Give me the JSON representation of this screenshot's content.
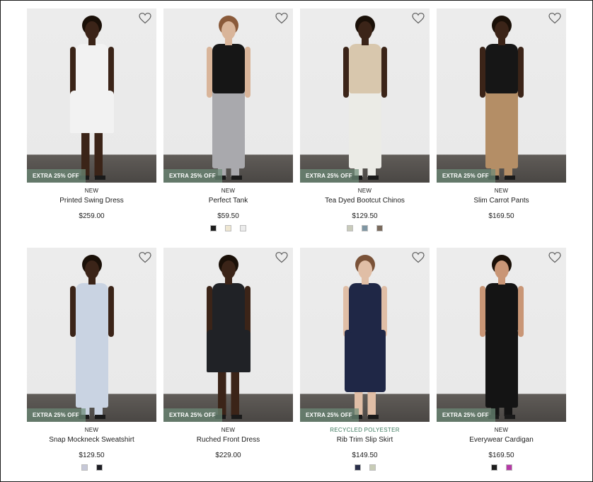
{
  "products": [
    {
      "badge": "NEW",
      "name": "Printed Swing Dress",
      "price": "$259.00",
      "promo": "EXTRA 25% OFF",
      "swatches": [],
      "figure": {
        "skin": "#3b2418",
        "hair": "#1a1008",
        "top": "#f2f2f2",
        "bottom": "#f2f2f2",
        "legs": "#3b2418",
        "style": "dress"
      }
    },
    {
      "badge": "NEW",
      "name": "Perfect Tank",
      "price": "$59.50",
      "promo": "EXTRA 25% OFF",
      "swatches": [
        "#1e1e1e",
        "#efe7d2",
        "#ececec"
      ],
      "figure": {
        "skin": "#d9b59a",
        "hair": "#8a5a3a",
        "top": "#161616",
        "bottom": "#a9a9ad",
        "legs": "#a9a9ad",
        "style": "pants"
      }
    },
    {
      "badge": "NEW",
      "name": "Tea Dyed Bootcut Chinos",
      "price": "$129.50",
      "promo": "EXTRA 25% OFF",
      "swatches": [
        "#c9cbbb",
        "#7f96a3",
        "#7a6a5c"
      ],
      "figure": {
        "skin": "#3b2418",
        "hair": "#1a1008",
        "top": "#d8c7ad",
        "bottom": "#ebebe6",
        "legs": "#ebebe6",
        "style": "pants"
      }
    },
    {
      "badge": "NEW",
      "name": "Slim Carrot Pants",
      "price": "$169.50",
      "promo": "EXTRA 25% OFF",
      "swatches": [],
      "figure": {
        "skin": "#3b2418",
        "hair": "#1a1008",
        "top": "#161616",
        "bottom": "#b48e66",
        "legs": "#b48e66",
        "style": "pants"
      }
    },
    {
      "badge": "NEW",
      "name": "Snap Mockneck Sweatshirt",
      "price": "$129.50",
      "promo": "EXTRA 25% OFF",
      "swatches": [
        "#c6c8d8",
        "#1e1e24"
      ],
      "figure": {
        "skin": "#3b2418",
        "hair": "#1a1008",
        "top": "#c9d3e2",
        "bottom": "#c9d3e2",
        "legs": "#c9d3e2",
        "style": "pants"
      }
    },
    {
      "badge": "NEW",
      "name": "Ruched Front Dress",
      "price": "$229.00",
      "promo": "EXTRA 25% OFF",
      "swatches": [],
      "figure": {
        "skin": "#3b2418",
        "hair": "#1a1008",
        "top": "#202226",
        "bottom": "#202226",
        "legs": "#3b2418",
        "style": "dress"
      }
    },
    {
      "badge": "RECYCLED POLYESTER",
      "badge_style": "green",
      "name": "Rib Trim Slip Skirt",
      "price": "$149.50",
      "promo": "EXTRA 25% OFF",
      "swatches": [
        "#2a2f4a",
        "#c8ccb6"
      ],
      "figure": {
        "skin": "#e0bea6",
        "hair": "#7a5238",
        "top": "#1f2746",
        "bottom": "#1f2746",
        "legs": "#e0bea6",
        "style": "skirt"
      }
    },
    {
      "badge": "NEW",
      "name": "Everywear Cardigan",
      "price": "$169.50",
      "promo": "EXTRA 25% OFF",
      "swatches": [
        "#1e1e1e",
        "#b63aa6"
      ],
      "figure": {
        "skin": "#c99676",
        "hair": "#1a1008",
        "top": "#141414",
        "bottom": "#141414",
        "legs": "#141414",
        "style": "pants"
      }
    }
  ]
}
